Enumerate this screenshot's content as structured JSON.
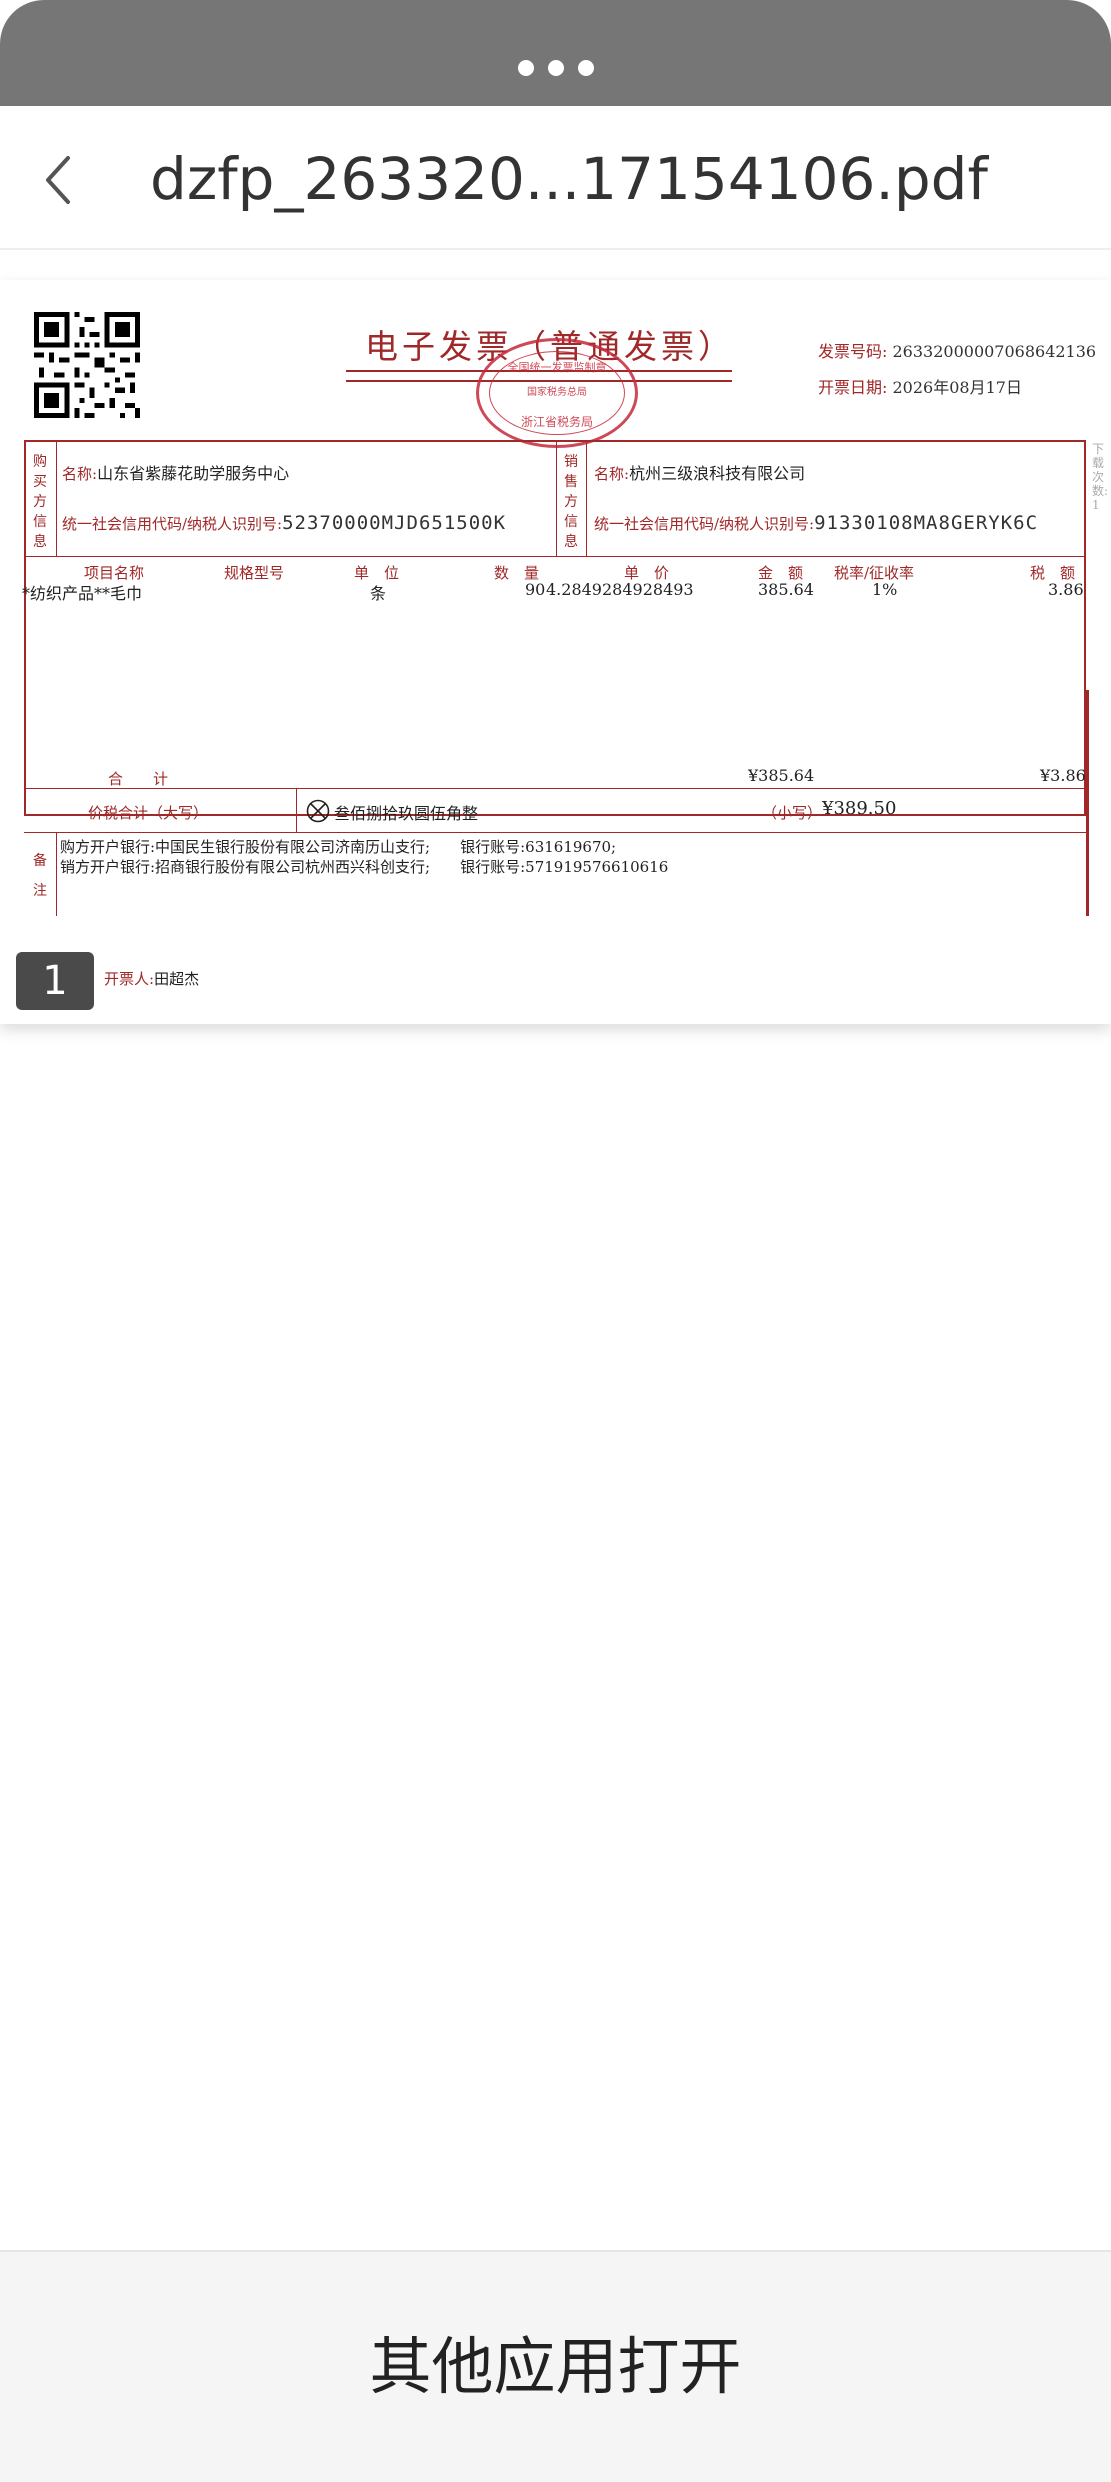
{
  "header": {
    "title": "dzfp_263320...17154106.pdf"
  },
  "invoice": {
    "title": "电子发票（普通发票）",
    "seal": {
      "top": "全国统一发票监制章",
      "mid": "国家税务总局",
      "bot": "浙江省税务局"
    },
    "number_label": "发票号码:",
    "number": "26332000007068642136",
    "date_label": "开票日期:",
    "date": "2026年08月17日",
    "buyer": {
      "section_label": "购买方信息",
      "name_label": "名称:",
      "name": "山东省紫藤花助学服务中心",
      "code_label": "统一社会信用代码/纳税人识别号:",
      "code": "52370000MJD651500K"
    },
    "seller": {
      "section_label": "销售方信息",
      "name_label": "名称:",
      "name": "杭州三级浪科技有限公司",
      "code_label": "统一社会信用代码/纳税人识别号:",
      "code": "91330108MA8GERYK6C"
    },
    "columns": {
      "item": "项目名称",
      "spec": "规格型号",
      "unit": "单　位",
      "qty": "数　量",
      "price": "单　价",
      "amount": "金　额",
      "rate": "税率/征收率",
      "tax": "税　额"
    },
    "items": [
      {
        "item": "*纺织产品**毛巾",
        "spec": "",
        "unit": "条",
        "qty": "90",
        "price": "4.2849284928493",
        "amount": "385.64",
        "rate": "1%",
        "tax": "3.86"
      }
    ],
    "subtotal_label": "合　　计",
    "subtotal_amount": "¥385.64",
    "subtotal_tax": "¥3.86",
    "total_caps_label": "价税合计（大写）",
    "total_caps": "叁佰捌拾玖圆伍角整",
    "total_small_label": "（小写）",
    "total_small": "¥389.50",
    "remarks_label": "备注",
    "remarks": [
      "购方开户银行:中国民生银行股份有限公司济南历山支行;　　银行账号:631619670;",
      "销方开户银行:招商银行股份有限公司杭州西兴科创支行;　　银行账号:571919576610616"
    ],
    "issuer_label": "开票人:",
    "issuer": "田超杰",
    "download_count": "下载次数: 1"
  },
  "page_indicator": "1",
  "bottom": {
    "open_label": "其他应用打开"
  }
}
